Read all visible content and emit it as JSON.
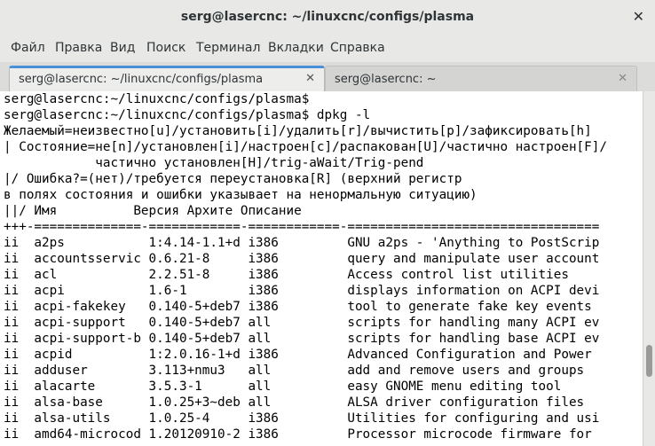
{
  "window": {
    "title": "serg@lasercnc: ~/linuxcnc/configs/plasma",
    "close_glyph": "✕"
  },
  "menu": [
    "Файл",
    "Правка",
    "Вид",
    "Поиск",
    "Терминал",
    "Вкладки",
    "Справка"
  ],
  "tabs": [
    {
      "label": "serg@lasercnc: ~/linuxcnc/configs/plasma",
      "close": "✕",
      "active": true
    },
    {
      "label": "serg@lasercnc: ~",
      "close": "✕",
      "active": false
    }
  ],
  "accent_color": "#4a90d9",
  "terminal": {
    "lines": [
      "serg@lasercnc:~/linuxcnc/configs/plasma$",
      "serg@lasercnc:~/linuxcnc/configs/plasma$ dpkg -l",
      "Желаемый=неизвестно[u]/установить[i]/удалить[r]/вычистить[p]/зафиксировать[h]",
      "| Состояние=не[n]/установлен[i]/настроен[c]/распакован[U]/частично настроен[F]/",
      "            частично установлен[H]/trig-aWait/Trig-pend",
      "|/ Ошибка?=(нет)/требуется переустановка[R] (верхний регистр",
      "в полях состояния и ошибки указывает на ненормальную ситуацию)",
      "||/ Имя          Версия Архите Описание",
      "+++-==============-============-============-=================================",
      "ii  a2ps           1:4.14-1.1+d i386         GNU a2ps - 'Anything to PostScrip",
      "ii  accountsservic 0.6.21-8     i386         query and manipulate user account",
      "ii  acl            2.2.51-8     i386         Access control list utilities",
      "ii  acpi           1.6-1        i386         displays information on ACPI devi",
      "ii  acpi-fakekey   0.140-5+deb7 i386         tool to generate fake key events",
      "ii  acpi-support   0.140-5+deb7 all          scripts for handling many ACPI ev",
      "ii  acpi-support-b 0.140-5+deb7 all          scripts for handling base ACPI ev",
      "ii  acpid          1:2.0.16-1+d i386         Advanced Configuration and Power",
      "ii  adduser        3.113+nmu3   all          add and remove users and groups",
      "ii  alacarte       3.5.3-1      all          easy GNOME menu editing tool",
      "ii  alsa-base      1.0.25+3~deb all          ALSA driver configuration files",
      "ii  alsa-utils     1.0.25-4     i386         Utilities for configuring and usi",
      "ii  amd64-microcod 1.20120910-2 i386         Processor microcode firmware for"
    ]
  }
}
